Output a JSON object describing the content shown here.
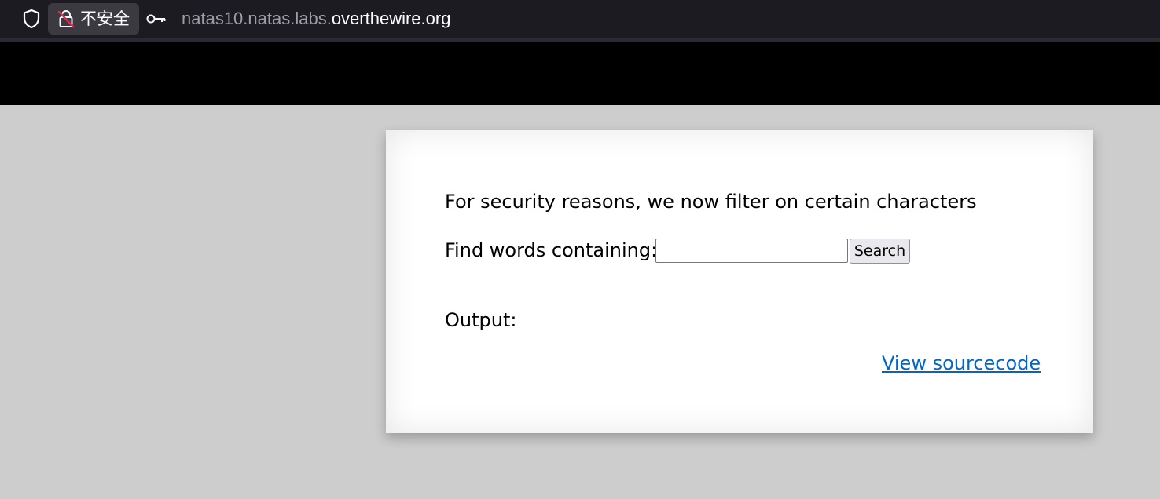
{
  "browser": {
    "insecure_label": "不安全",
    "url_subdomain": "natas10.natas.labs.",
    "url_domain": "overthewire.org",
    "icons": {
      "shield": "shield-icon",
      "lock": "lock-insecure-icon",
      "key": "key-icon"
    }
  },
  "page": {
    "notice": "For security reasons, we now filter on certain characters",
    "find_label": "Find words containing:",
    "search_value": "",
    "search_button": "Search",
    "output_label": "Output:",
    "source_link": "View sourcecode"
  },
  "colors": {
    "page_background": "#cdcdcd",
    "banner": "#000000",
    "card": "#ffffff",
    "link": "#0066cc",
    "toolbar": "#1c1b22"
  }
}
